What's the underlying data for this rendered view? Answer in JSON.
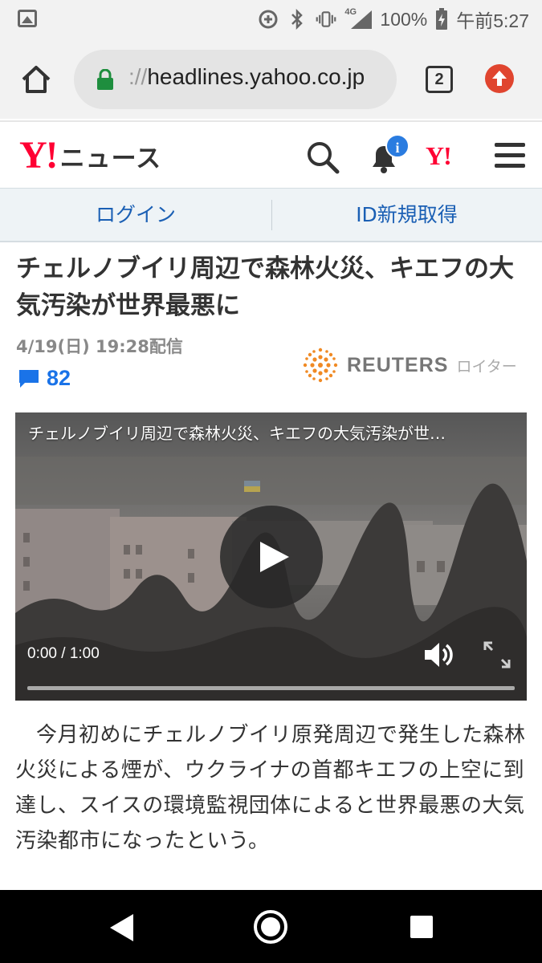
{
  "status_bar": {
    "network_label": "4G",
    "battery": "100%",
    "time": "午前5:27",
    "icons": [
      "image-icon",
      "data-saver-icon",
      "bluetooth-icon",
      "vibrate-icon",
      "signal-icon",
      "battery-charging-icon"
    ]
  },
  "browser": {
    "url_scheme": "://",
    "url_host": "headlines.yahoo.co.jp",
    "tab_count": "2",
    "icons": [
      "home-icon",
      "lock-icon",
      "tabs-icon",
      "update-icon"
    ]
  },
  "header": {
    "logo_mark": "Y!",
    "logo_text": "ニュース",
    "notification_badge": "i",
    "yahoo_mark": "Y!",
    "icons": [
      "search-icon",
      "bell-icon",
      "menu-icon"
    ],
    "colors": {
      "brand": "#ff0033",
      "badge": "#2a7ce0"
    }
  },
  "account_bar": {
    "login_label": "ログイン",
    "register_label": "ID新規取得"
  },
  "article": {
    "headline": "チェルノブイリ周辺で森林火災、キエフの大気汚染が世界最悪に",
    "published": "4/19(日) 19:28配信",
    "comment_count": "82",
    "source_name": "REUTERS",
    "source_kana": "ロイター",
    "body": "今月初めにチェルノブイリ原発周辺で発生した森林火災による煙が、ウクライナの首都キエフの上空に到達し、スイスの環境監視団体によると世界最悪の大気汚染都市になったという。"
  },
  "video": {
    "title": "チェルノブイリ周辺で森林火災、キエフの大気汚染が世…",
    "current_time": "0:00",
    "separator": "/",
    "duration": "1:00",
    "progress": 0.0,
    "icons": [
      "play-icon",
      "volume-icon",
      "fullscreen-icon"
    ]
  },
  "nav_bar": {
    "icons": [
      "back-icon",
      "home-circle-icon",
      "recents-icon"
    ]
  }
}
